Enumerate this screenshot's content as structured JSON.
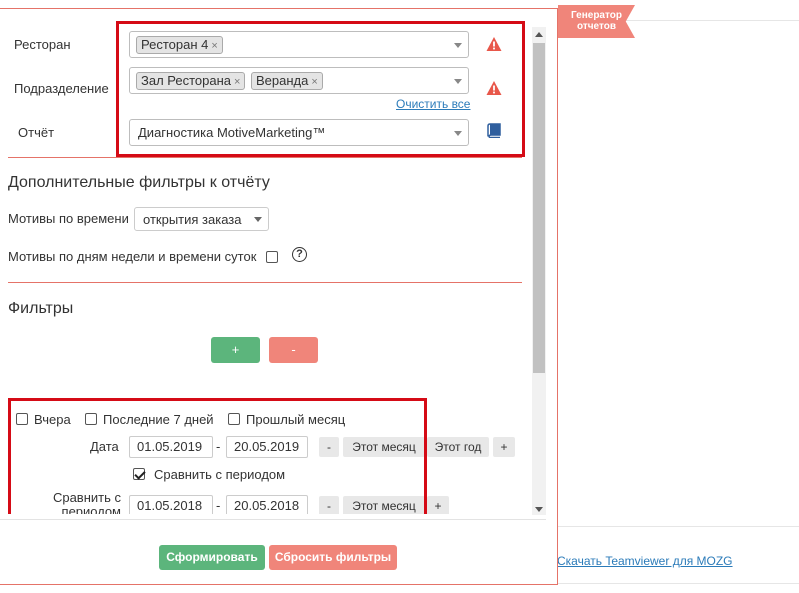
{
  "filters_main": {
    "restaurant_label": "Ресторан",
    "restaurant_tags": [
      "Ресторан 4"
    ],
    "department_label": "Подразделение",
    "department_tags": [
      "Зал Ресторана",
      "Веранда"
    ],
    "clear_all": "Очистить все",
    "report_label": "Отчёт",
    "report_value": "Диагностика MotiveMarketing™"
  },
  "additional": {
    "title": "Дополнительные фильтры к отчёту",
    "time_motives_label": "Мотивы по времени",
    "time_motives_value": "открытия заказа",
    "weekday_label": "Мотивы по дням недели и времени суток",
    "weekday_checked": false,
    "help_symbol": "?"
  },
  "filters": {
    "title": "Фильтры",
    "add_label": "+",
    "remove_label": "-"
  },
  "period": {
    "yesterday": "Вчера",
    "last7": "Последние 7 дней",
    "last_month": "Прошлый месяц",
    "date_label": "Дата",
    "date_from": "01.05.2019",
    "date_to": "20.05.2019",
    "dash": "-",
    "minus": "-",
    "this_month": "Этот месяц",
    "this_year": "Этот год",
    "plus": "+",
    "compare_label": "Сравнить с периодом",
    "compare_checked": true,
    "compare_with_label_1": "Сравнить с",
    "compare_with_label_2": "периодом",
    "cmp_from": "01.05.2018",
    "cmp_to": "20.05.2018"
  },
  "actions": {
    "generate": "Сформировать",
    "reset": "Сбросить фильтры"
  },
  "side": {
    "ribbon_line1": "Генератор",
    "ribbon_line2": "отчетов",
    "teamviewer": "Скачать Teamviewer для MOZG"
  },
  "colors": {
    "accent_red": "#d50b16",
    "green": "#5cb57c",
    "salmon": "#f0857a",
    "link": "#2b7bb9"
  }
}
